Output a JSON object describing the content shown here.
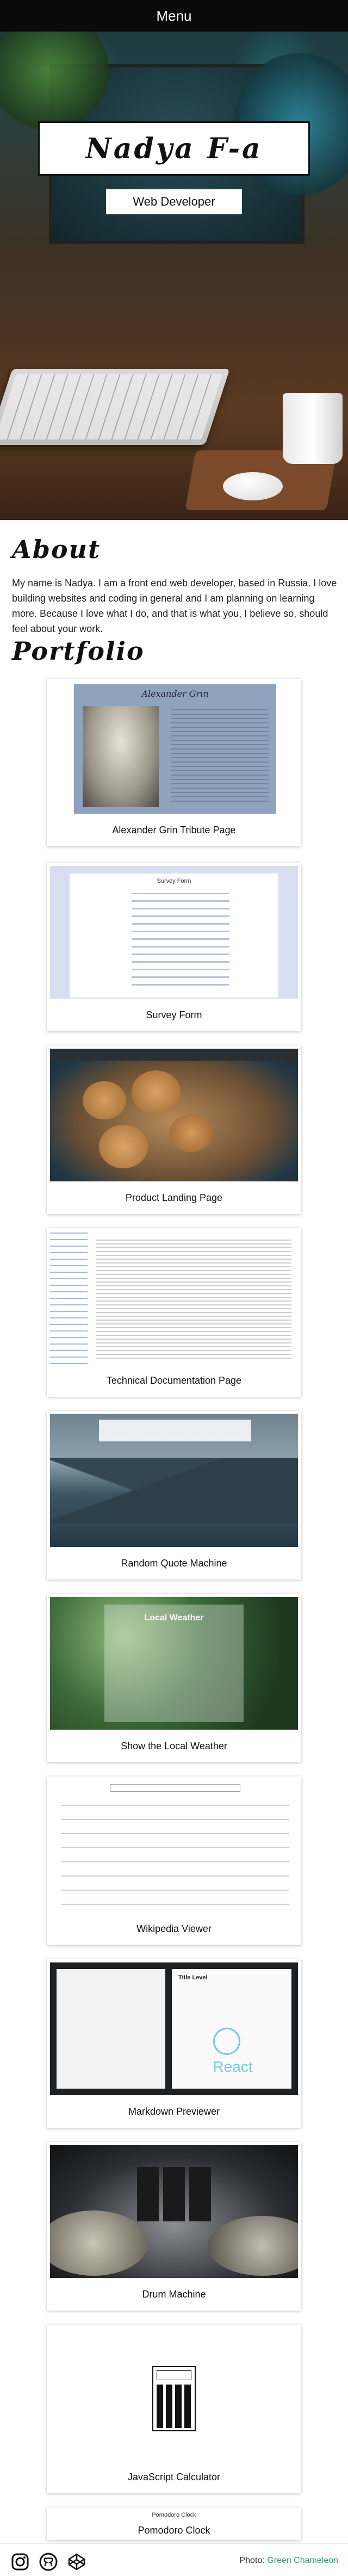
{
  "nav": {
    "menu_label": "Menu"
  },
  "hero": {
    "name": "Nadya F-a",
    "role": "Web Developer"
  },
  "about": {
    "title": "About",
    "text": "My name is Nadya. I am a front end web developer, based in Russia. I love building websites and coding in general and I am planning on learning more. Because I love what I do, and that is what you, I believe so, should feel about your work."
  },
  "portfolio": {
    "title": "Portfolio",
    "items": [
      {
        "label": "Alexander Grin Tribute Page"
      },
      {
        "label": "Survey Form"
      },
      {
        "label": "Product Landing Page"
      },
      {
        "label": "Technical Documentation Page"
      },
      {
        "label": "Random Quote Machine"
      },
      {
        "label": "Show the Local Weather"
      },
      {
        "label": "Wikipedia Viewer"
      },
      {
        "label": "Markdown Previewer"
      },
      {
        "label": "Drum Machine"
      },
      {
        "label": "JavaScript Calculator"
      },
      {
        "label": "Pomodoro Clock"
      }
    ]
  },
  "thumbs": {
    "grin_title": "Alexander Grin",
    "survey_title": "Survey Form",
    "weather_title": "Local Weather",
    "react_word": "React",
    "pomodoro_title": "Pomodoro Clock",
    "markdown_heading": "Title Level"
  },
  "footer": {
    "credit_prefix": "Photo: ",
    "credit_link": "Green Chameleon",
    "icons": [
      "instagram-icon",
      "github-icon",
      "codepen-icon"
    ]
  }
}
